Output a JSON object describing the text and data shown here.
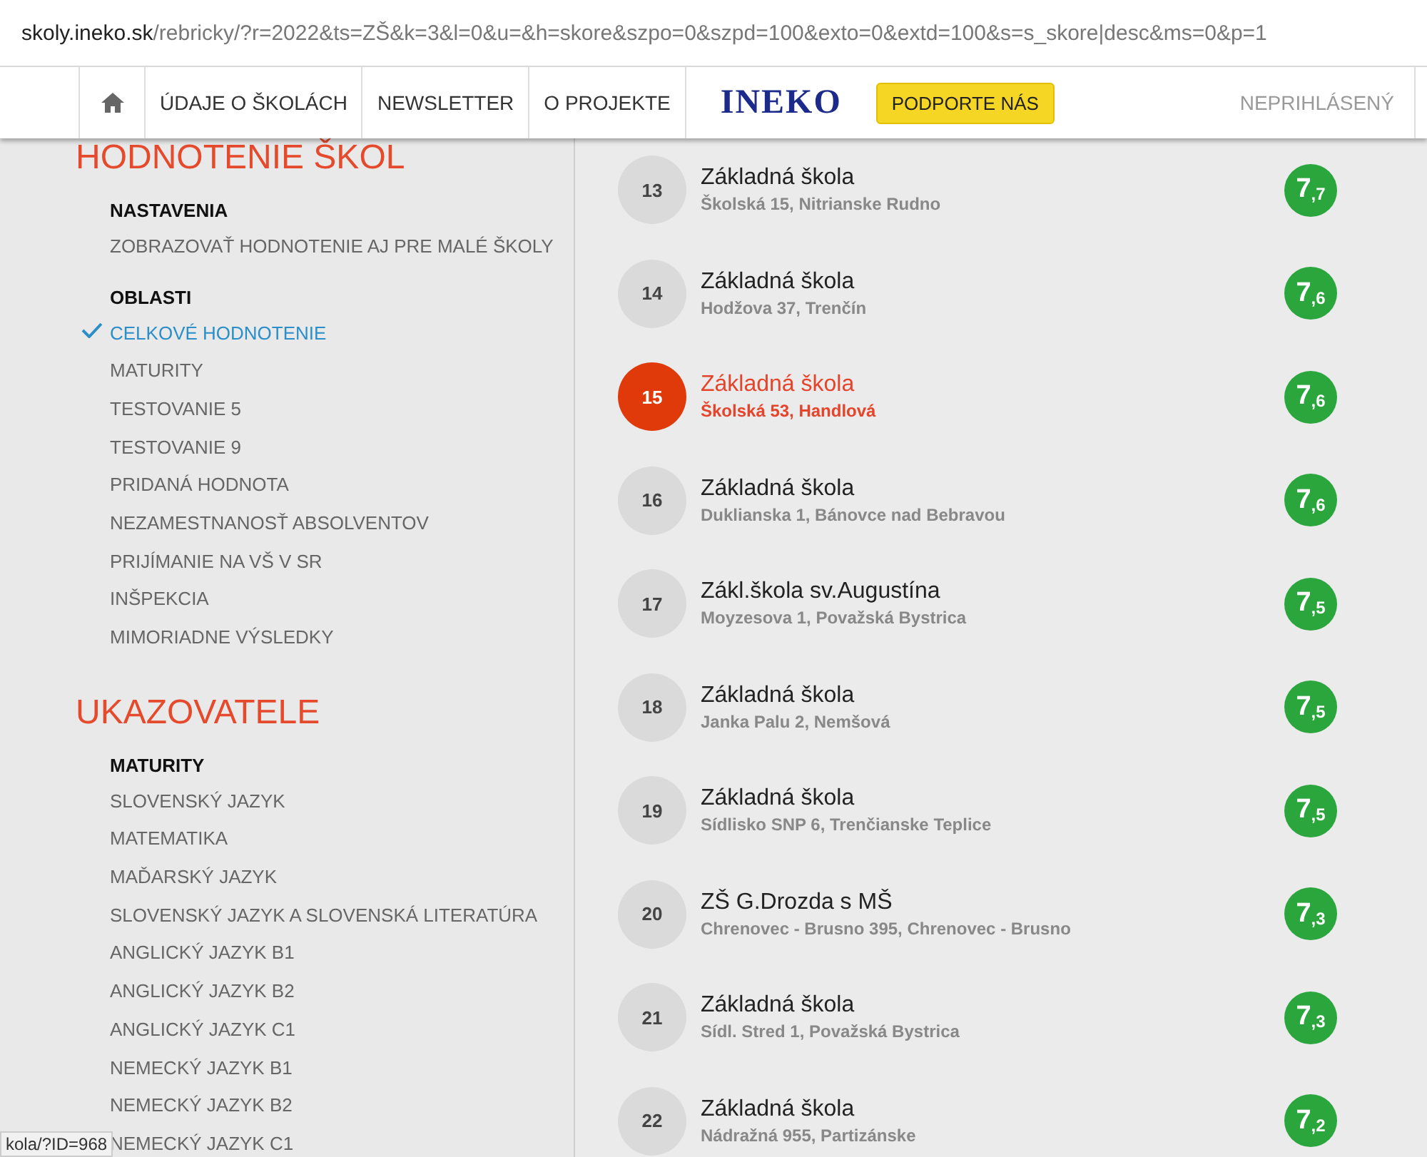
{
  "address_bar": {
    "host": "skoly.ineko.sk",
    "path": "/rebricky/?r=2022&ts=ZŠ&k=3&l=0&u=&h=skore&szpo=0&szpd=100&exto=0&extd=100&s=s_skore|desc&ms=0&p=1"
  },
  "nav": {
    "items": [
      "ÚDAJE O ŠKOLÁCH",
      "NEWSLETTER",
      "O PROJEKTE"
    ],
    "logo": "INEKO",
    "support_button": "PODPORTE NÁS",
    "user": "NEPRIHLÁSENÝ"
  },
  "sidebar": {
    "sections": [
      {
        "title": "HODNOTENIE ŠKOL",
        "groups": [
          {
            "heading": "NASTAVENIA",
            "items": [
              {
                "label": "ZOBRAZOVAŤ HODNOTENIE AJ PRE MALÉ ŠKOLY",
                "selected": false
              }
            ]
          },
          {
            "heading": "OBLASTI",
            "items": [
              {
                "label": "CELKOVÉ HODNOTENIE",
                "selected": true
              },
              {
                "label": "MATURITY",
                "selected": false
              },
              {
                "label": "TESTOVANIE 5",
                "selected": false
              },
              {
                "label": "TESTOVANIE 9",
                "selected": false
              },
              {
                "label": "PRIDANÁ HODNOTA",
                "selected": false
              },
              {
                "label": "NEZAMESTNANOSŤ ABSOLVENTOV",
                "selected": false
              },
              {
                "label": "PRIJÍMANIE NA VŠ V SR",
                "selected": false
              },
              {
                "label": "INŠPEKCIA",
                "selected": false
              },
              {
                "label": "MIMORIADNE VÝSLEDKY",
                "selected": false
              }
            ]
          }
        ]
      },
      {
        "title": "UKAZOVATELE",
        "groups": [
          {
            "heading": "MATURITY",
            "items": [
              {
                "label": "SLOVENSKÝ JAZYK",
                "selected": false
              },
              {
                "label": "MATEMATIKA",
                "selected": false
              },
              {
                "label": "MAĎARSKÝ JAZYK",
                "selected": false
              },
              {
                "label": "SLOVENSKÝ JAZYK A SLOVENSKÁ LITERATÚRA",
                "selected": false
              },
              {
                "label": "ANGLICKÝ JAZYK B1",
                "selected": false
              },
              {
                "label": "ANGLICKÝ JAZYK B2",
                "selected": false
              },
              {
                "label": "ANGLICKÝ JAZYK C1",
                "selected": false
              },
              {
                "label": "NEMECKÝ JAZYK B1",
                "selected": false
              },
              {
                "label": "NEMECKÝ JAZYK B2",
                "selected": false
              },
              {
                "label": "NEMECKÝ JAZYK C1",
                "selected": false
              }
            ]
          }
        ]
      }
    ]
  },
  "schools": [
    {
      "rank": "13",
      "name": "Základná škola",
      "address": "Školská 15, Nitrianske Rudno",
      "score": "7",
      "score_decimal": ",7",
      "selected": false
    },
    {
      "rank": "14",
      "name": "Základná škola",
      "address": "Hodžova 37, Trenčín",
      "score": "7",
      "score_decimal": ",6",
      "selected": false
    },
    {
      "rank": "15",
      "name": "Základná škola",
      "address": "Školská 53, Handlová",
      "score": "7",
      "score_decimal": ",6",
      "selected": true
    },
    {
      "rank": "16",
      "name": "Základná škola",
      "address": "Duklianska 1, Bánovce nad Bebravou",
      "score": "7",
      "score_decimal": ",6",
      "selected": false
    },
    {
      "rank": "17",
      "name": "Zákl.škola sv.Augustína",
      "address": "Moyzesova 1, Považská Bystrica",
      "score": "7",
      "score_decimal": ",5",
      "selected": false
    },
    {
      "rank": "18",
      "name": "Základná škola",
      "address": "Janka Palu 2, Nemšová",
      "score": "7",
      "score_decimal": ",5",
      "selected": false
    },
    {
      "rank": "19",
      "name": "Základná škola",
      "address": "Sídlisko SNP 6, Trenčianske Teplice",
      "score": "7",
      "score_decimal": ",5",
      "selected": false
    },
    {
      "rank": "20",
      "name": "ZŠ G.Drozda s MŠ",
      "address": "Chrenovec - Brusno 395, Chrenovec - Brusno",
      "score": "7",
      "score_decimal": ",3",
      "selected": false
    },
    {
      "rank": "21",
      "name": "Základná škola",
      "address": "Sídl. Stred 1, Považská Bystrica",
      "score": "7",
      "score_decimal": ",3",
      "selected": false
    },
    {
      "rank": "22",
      "name": "Základná škola",
      "address": "Nádražná 955, Partizánske",
      "score": "7",
      "score_decimal": ",2",
      "selected": false
    }
  ],
  "status_bar": "kola/?ID=968"
}
